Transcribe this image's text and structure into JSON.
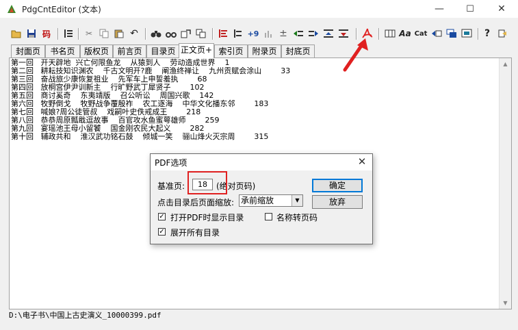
{
  "window": {
    "title": "PdgCntEditor  (文本)",
    "min": "—",
    "max": "☐",
    "close": "✕"
  },
  "toolbar": {
    "icons": [
      "open-icon",
      "save-icon",
      "encoding-icon",
      "outline-icon",
      "cut-icon",
      "copy-icon",
      "paste-icon",
      "undo-icon",
      "find-icon",
      "find-next-icon",
      "replace-icon",
      "replace-all-icon",
      "align-icon",
      "indent-icon",
      "page-offset-icon",
      "level-icon",
      "add-icon",
      "move-up-icon",
      "move-down-icon",
      "promote-icon",
      "demote-icon",
      "pdf-icon",
      "table-icon",
      "font-icon",
      "cat-icon",
      "export-icon",
      "window-icon",
      "screen-icon",
      "help-icon",
      "about-icon"
    ],
    "labels": {
      "encoding": "码",
      "font": "Aa",
      "cat": "Cat",
      "help": "?",
      "offset": "+9"
    }
  },
  "tabs": [
    "封面页",
    "书名页",
    "版权页",
    "前言页",
    "目录页",
    "正文页+",
    "索引页",
    "附录页",
    "封底页"
  ],
  "active_tab": "正文页+",
  "content": {
    "lines": [
      "第一回   开天辟地  兴亡何限鱼龙    从猿到人    劳动造成世界    1",
      "第二回   耕耘技知识渊农    千古文明开?鹿    阐渔终禅让    九州贡赋会涂山        33",
      "第三回   奋战旅少康恢复祖业    先军车上申誓羞执        68",
      "第四回   放桐宫伊尹训新主    行旷野武丁犀贤子        102",
      "第五回   商讨奚奇    东夷靖版    召公听讼    周国兴歌    142",
      "第六回   牧野倒戈    牧野战争覆殷祚    农工逐海    中华文化播东邻        183",
      "第七回   喊娘?周公徒管叔    戏嗣叶史佚戒成王        218",
      "第八回   恭恭周原瓢戢逗故事    百官攻水鱼蜜萼雄师        259",
      "第九回   宴瑶池王母小留饕    国金刚农民大起义        282",
      "第十回   辅政共和    淮汉武功铭石鼓    倾城一笑    骊山烽火灭宗周        315"
    ]
  },
  "status": {
    "path": "D:\\电子书\\中国上古史演义_10000399.pdf"
  },
  "dialog": {
    "title": "PDF选项",
    "base_page_label": "基准页:",
    "base_page_value": "18",
    "base_page_hint": "(绝对页码)",
    "zoom_label": "点击目录后页面缩放:",
    "zoom_value": "承前缩放",
    "ok": "确定",
    "cancel": "放弃",
    "opt_show_outline": "打开PDF时显示目录",
    "opt_name_to_page": "名称转页码",
    "opt_expand_all": "展开所有目录",
    "checked_show_outline": "✓",
    "checked_name_to_page": "",
    "checked_expand_all": "✓"
  },
  "colors": {
    "annotation": "#e02020",
    "accent": "#0078d7"
  }
}
